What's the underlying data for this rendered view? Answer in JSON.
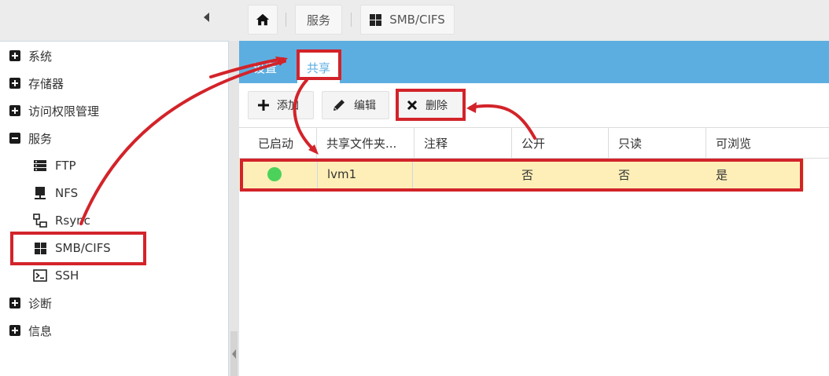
{
  "breadcrumb": {
    "home_icon": "home-icon",
    "items": [
      {
        "label": "服务"
      },
      {
        "label": "SMB/CIFS",
        "icon": "windows-icon"
      }
    ]
  },
  "sidebar": {
    "items": [
      {
        "label": "系统",
        "toggle": "plus"
      },
      {
        "label": "存储器",
        "toggle": "plus"
      },
      {
        "label": "访问权限管理",
        "toggle": "plus"
      },
      {
        "label": "服务",
        "toggle": "minus",
        "children": [
          {
            "label": "FTP",
            "icon": "server-icon"
          },
          {
            "label": "NFS",
            "icon": "monitor-icon"
          },
          {
            "label": "Rsync",
            "icon": "network-icon"
          },
          {
            "label": "SMB/CIFS",
            "icon": "windows-icon",
            "selected": true
          },
          {
            "label": "SSH",
            "icon": "terminal-icon"
          }
        ]
      },
      {
        "label": "诊断",
        "toggle": "plus"
      },
      {
        "label": "信息",
        "toggle": "plus"
      }
    ]
  },
  "tabs": {
    "settings": "设置",
    "share": "共享",
    "active": "share"
  },
  "toolbar": {
    "add_label": "添加",
    "edit_label": "编辑",
    "delete_label": "删除"
  },
  "grid": {
    "columns": [
      "已启动",
      "共享文件夹...",
      "注释",
      "公开",
      "只读",
      "可浏览"
    ],
    "rows": [
      {
        "enabled": true,
        "shared_folder": "lvm1",
        "comment": "",
        "public": "否",
        "read_only": "否",
        "browsable": "是"
      }
    ]
  },
  "colors": {
    "tabbar": "#5daee0",
    "selected_row": "#feefb8",
    "enabled_dot": "#4cd25a",
    "annotation": "#d3232a"
  }
}
